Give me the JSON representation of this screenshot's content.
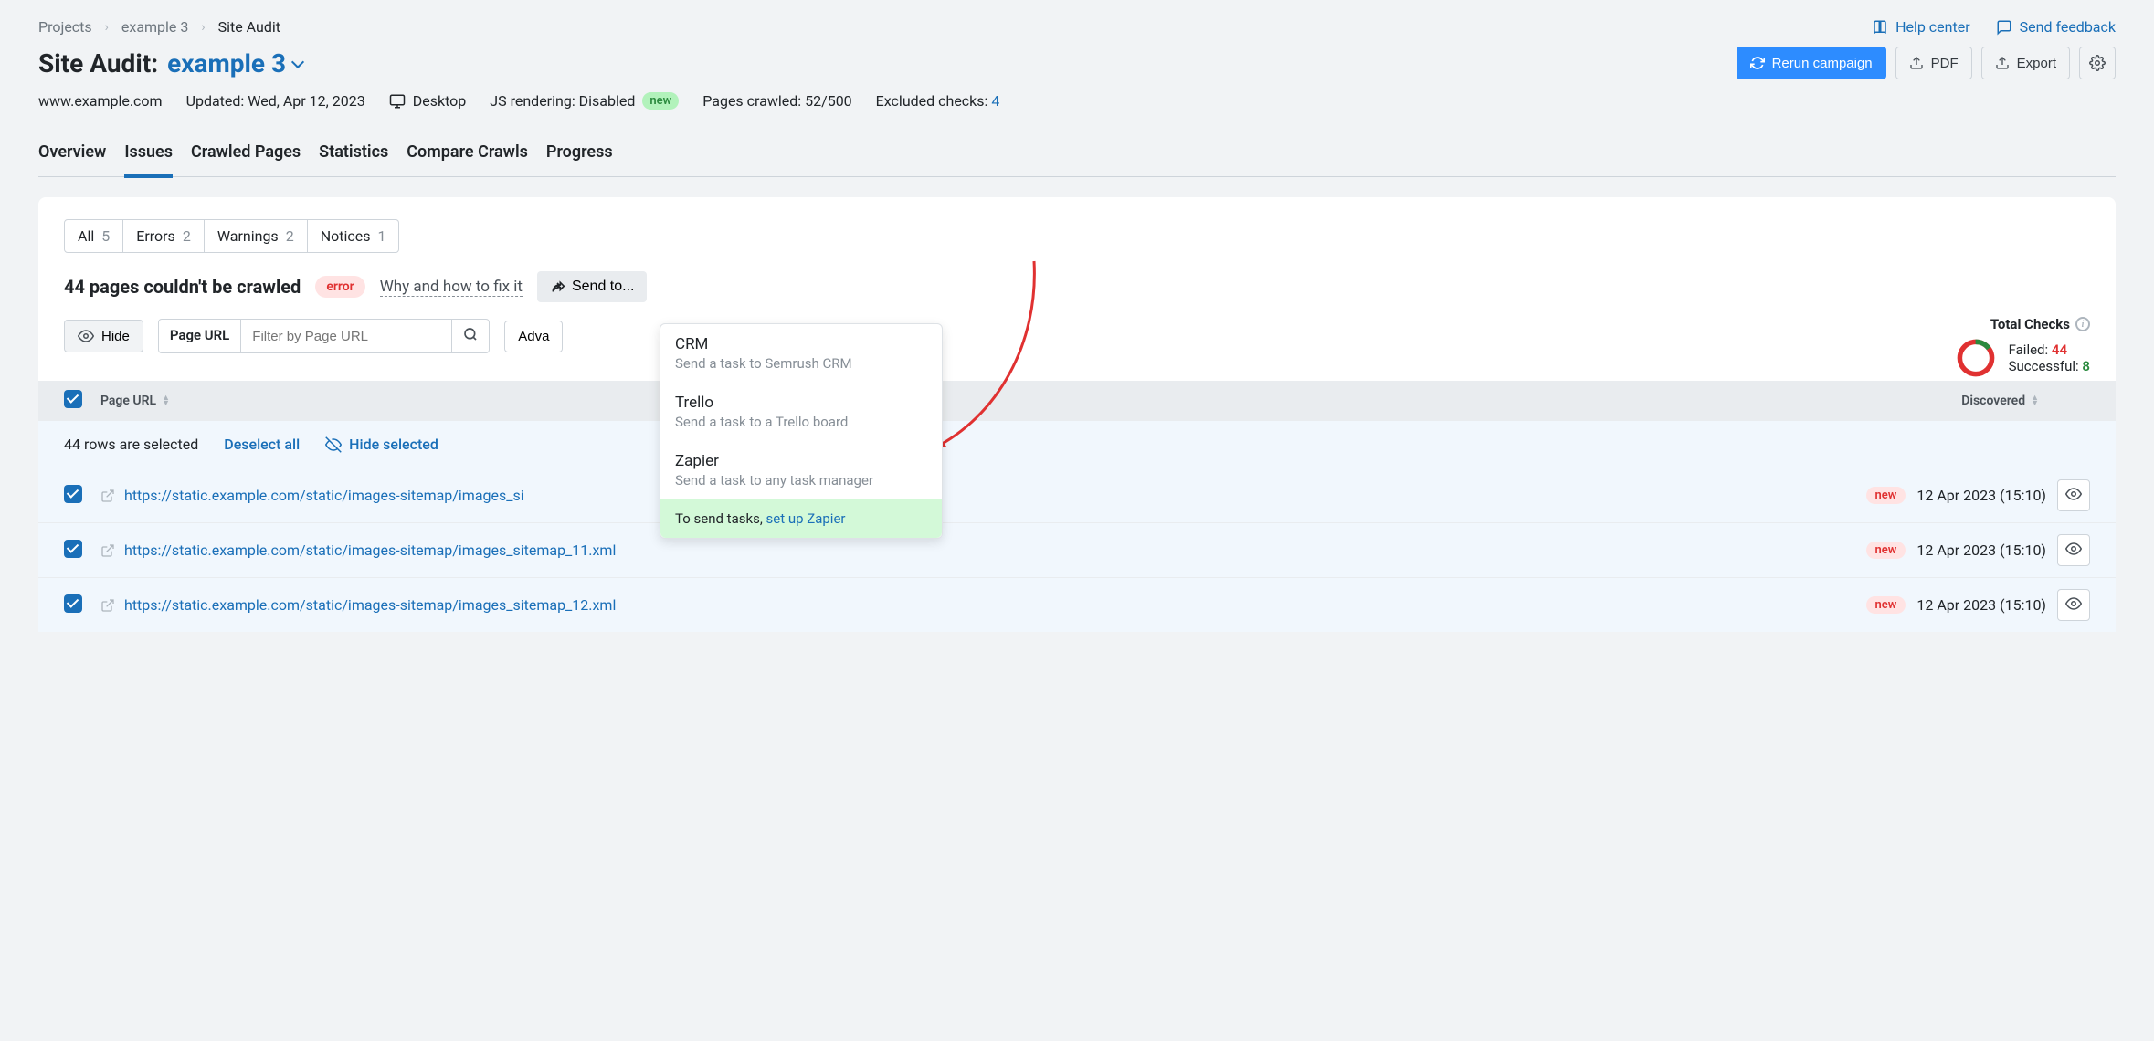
{
  "breadcrumb": {
    "root": "Projects",
    "project": "example 3",
    "page": "Site Audit"
  },
  "topLinks": {
    "help": "Help center",
    "feedback": "Send feedback"
  },
  "title": {
    "prefix": "Site Audit:",
    "project": "example 3"
  },
  "actions": {
    "rerun": "Rerun campaign",
    "pdf": "PDF",
    "export": "Export"
  },
  "info": {
    "domain": "www.example.com",
    "updated": "Updated: Wed, Apr 12, 2023",
    "device": "Desktop",
    "js": "JS rendering: Disabled",
    "jsBadge": "new",
    "crawled": "Pages crawled: 52/500",
    "excluded": "Excluded checks:",
    "excludedCount": "4"
  },
  "tabs": [
    "Overview",
    "Issues",
    "Crawled Pages",
    "Statistics",
    "Compare Crawls",
    "Progress"
  ],
  "filterTabs": [
    {
      "label": "All",
      "count": "5"
    },
    {
      "label": "Errors",
      "count": "2"
    },
    {
      "label": "Warnings",
      "count": "2"
    },
    {
      "label": "Notices",
      "count": "1"
    }
  ],
  "issue": {
    "title": "44 pages couldn't be crawled",
    "badge": "error",
    "fixLink": "Why and how to fix it",
    "sendTo": "Send to..."
  },
  "sendMenu": {
    "items": [
      {
        "title": "CRM",
        "sub": "Send a task to Semrush CRM"
      },
      {
        "title": "Trello",
        "sub": "Send a task to a Trello board"
      },
      {
        "title": "Zapier",
        "sub": "Send a task to any task manager"
      }
    ],
    "footerText": "To send tasks, ",
    "footerLink": "set up Zapier"
  },
  "toolbar": {
    "hide": "Hide",
    "filterLabel": "Page URL",
    "filterPlaceholder": "Filter by Page URL",
    "advanced": "Adva"
  },
  "stats": {
    "label": "Total Checks",
    "failedLabel": "Failed:",
    "failedCount": "44",
    "successLabel": "Successful:",
    "successCount": "8"
  },
  "tableHead": {
    "url": "Page URL",
    "discovered": "Discovered"
  },
  "selection": {
    "text": "44 rows are selected",
    "deselect": "Deselect all",
    "hideSelected": "Hide selected"
  },
  "rows": [
    {
      "url": "https://static.example.com/static/images-sitemap/images_si",
      "badge": "new",
      "date": "12 Apr 2023 (15:10)"
    },
    {
      "url": "https://static.example.com/static/images-sitemap/images_sitemap_11.xml",
      "badge": "new",
      "date": "12 Apr 2023 (15:10)"
    },
    {
      "url": "https://static.example.com/static/images-sitemap/images_sitemap_12.xml",
      "badge": "new",
      "date": "12 Apr 2023 (15:10)"
    }
  ]
}
